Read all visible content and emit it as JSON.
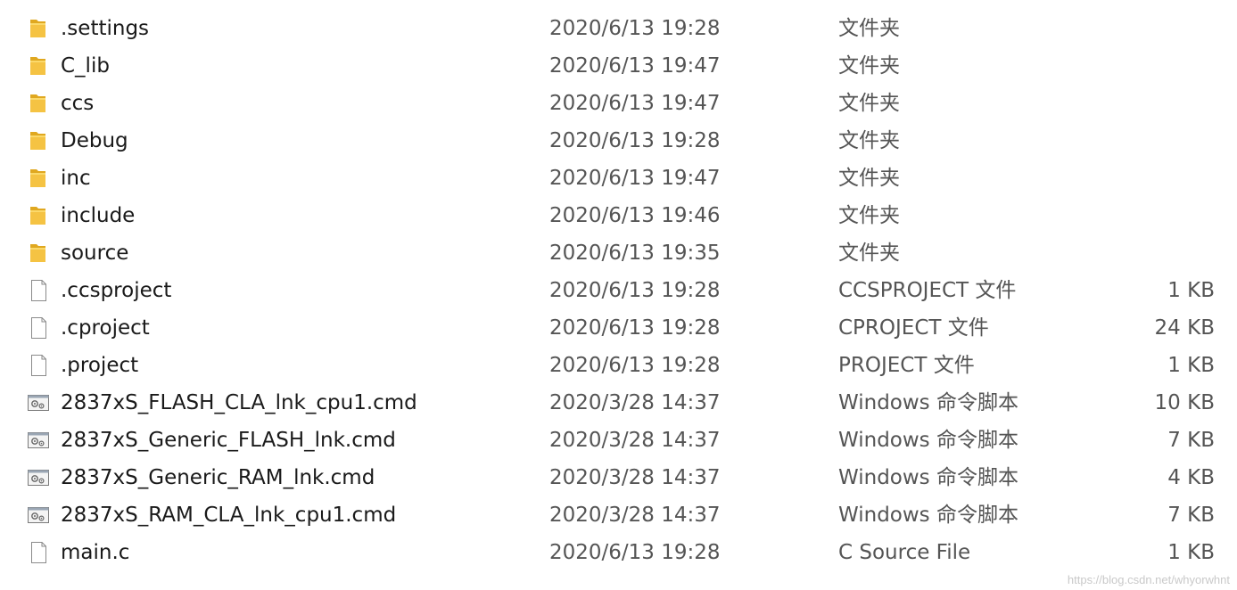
{
  "files": [
    {
      "name": ".settings",
      "date": "2020/6/13 19:28",
      "type": "文件夹",
      "size": "",
      "icon": "folder-icon"
    },
    {
      "name": "C_lib",
      "date": "2020/6/13 19:47",
      "type": "文件夹",
      "size": "",
      "icon": "folder-icon"
    },
    {
      "name": "ccs",
      "date": "2020/6/13 19:47",
      "type": "文件夹",
      "size": "",
      "icon": "folder-icon"
    },
    {
      "name": "Debug",
      "date": "2020/6/13 19:28",
      "type": "文件夹",
      "size": "",
      "icon": "folder-icon"
    },
    {
      "name": "inc",
      "date": "2020/6/13 19:47",
      "type": "文件夹",
      "size": "",
      "icon": "folder-icon"
    },
    {
      "name": "include",
      "date": "2020/6/13 19:46",
      "type": "文件夹",
      "size": "",
      "icon": "folder-icon"
    },
    {
      "name": "source",
      "date": "2020/6/13 19:35",
      "type": "文件夹",
      "size": "",
      "icon": "folder-icon"
    },
    {
      "name": ".ccsproject",
      "date": "2020/6/13 19:28",
      "type": "CCSPROJECT 文件",
      "size": "1 KB",
      "icon": "file-icon"
    },
    {
      "name": ".cproject",
      "date": "2020/6/13 19:28",
      "type": "CPROJECT 文件",
      "size": "24 KB",
      "icon": "file-icon"
    },
    {
      "name": ".project",
      "date": "2020/6/13 19:28",
      "type": "PROJECT 文件",
      "size": "1 KB",
      "icon": "file-icon"
    },
    {
      "name": "2837xS_FLASH_CLA_lnk_cpu1.cmd",
      "date": "2020/3/28 14:37",
      "type": "Windows 命令脚本",
      "size": "10 KB",
      "icon": "cmd-script-icon"
    },
    {
      "name": "2837xS_Generic_FLASH_lnk.cmd",
      "date": "2020/3/28 14:37",
      "type": "Windows 命令脚本",
      "size": "7 KB",
      "icon": "cmd-script-icon"
    },
    {
      "name": "2837xS_Generic_RAM_lnk.cmd",
      "date": "2020/3/28 14:37",
      "type": "Windows 命令脚本",
      "size": "4 KB",
      "icon": "cmd-script-icon"
    },
    {
      "name": "2837xS_RAM_CLA_lnk_cpu1.cmd",
      "date": "2020/3/28 14:37",
      "type": "Windows 命令脚本",
      "size": "7 KB",
      "icon": "cmd-script-icon"
    },
    {
      "name": "main.c",
      "date": "2020/6/13 19:28",
      "type": "C Source File",
      "size": "1 KB",
      "icon": "file-icon"
    }
  ],
  "watermark": "https://blog.csdn.net/whyorwhnt",
  "colors": {
    "folder": "#f5c343",
    "folder_tab": "#e0a820",
    "file_border": "#8a8a8a",
    "text_secondary": "#555555"
  }
}
